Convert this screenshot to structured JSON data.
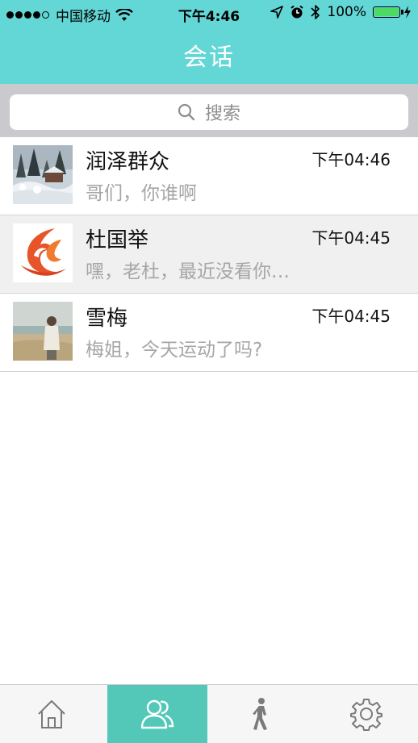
{
  "status_bar": {
    "carrier": "中国移动",
    "time": "下午4:46",
    "battery_percent": "100%"
  },
  "nav": {
    "title": "会话"
  },
  "search": {
    "placeholder": "搜索"
  },
  "conversations": [
    {
      "name": "润泽群众",
      "preview": "哥们，你谁啊",
      "time": "下午04:46",
      "avatar": "snowy-winter-scene-photo"
    },
    {
      "name": "杜国举",
      "preview": "嘿，老杜，最近没看你…",
      "time": "下午04:45",
      "avatar": "orange-flame-logo"
    },
    {
      "name": "雪梅",
      "preview": "梅姐，今天运动了吗?",
      "time": "下午04:45",
      "avatar": "beach-person-photo"
    }
  ],
  "tab_bar": {
    "items": [
      {
        "icon": "home-icon",
        "selected": false
      },
      {
        "icon": "contacts-icon",
        "selected": true
      },
      {
        "icon": "walking-person-icon",
        "selected": false
      },
      {
        "icon": "gear-icon",
        "selected": false
      }
    ]
  },
  "colors": {
    "accent": "#63d6d6",
    "active_tab": "#53c8b9",
    "search_bg": "#c9c9ce",
    "battery": "#4cd964"
  }
}
